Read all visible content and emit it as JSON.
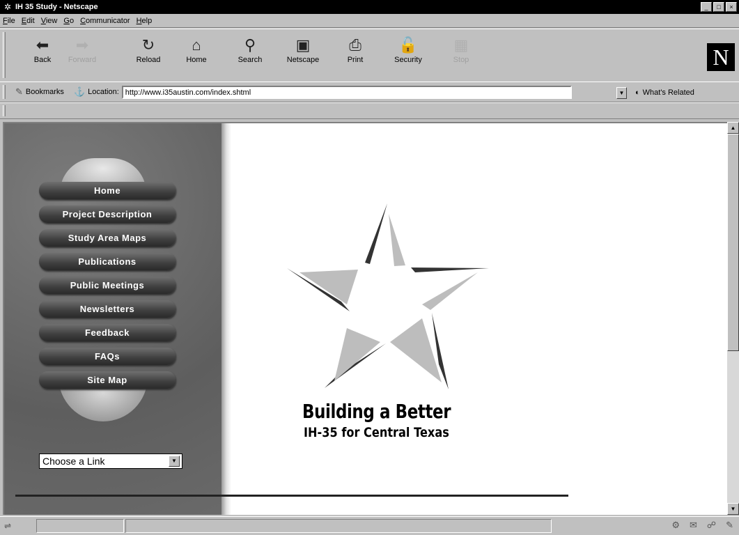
{
  "window": {
    "title": "IH 35 Study - Netscape",
    "controls": [
      "_",
      "□",
      "×"
    ]
  },
  "menu": [
    "File",
    "Edit",
    "View",
    "Go",
    "Communicator",
    "Help"
  ],
  "nav_buttons": [
    {
      "label": "Back",
      "icon": "back-arrow-icon",
      "glyph": "⬅",
      "enabled": true
    },
    {
      "label": "Forward",
      "icon": "forward-arrow-icon",
      "glyph": "➡",
      "enabled": false
    },
    {
      "label": "Reload",
      "icon": "reload-icon",
      "glyph": "↻",
      "enabled": true
    },
    {
      "label": "Home",
      "icon": "home-icon",
      "glyph": "⌂",
      "enabled": true
    },
    {
      "label": "Search",
      "icon": "search-icon",
      "glyph": "⚲",
      "enabled": true
    },
    {
      "label": "Netscape",
      "icon": "netscape-icon",
      "glyph": "▣",
      "enabled": true
    },
    {
      "label": "Print",
      "icon": "print-icon",
      "glyph": "⎙",
      "enabled": true
    },
    {
      "label": "Security",
      "icon": "security-lock-icon",
      "glyph": "🔓",
      "enabled": true
    },
    {
      "label": "Stop",
      "icon": "stop-icon",
      "glyph": "▦",
      "enabled": false
    }
  ],
  "netscape_logo": "N",
  "location": {
    "bookmarks_label": "Bookmarks",
    "location_label": "Location:",
    "url": "http://www.i35austin.com/index.shtml",
    "related_label": "What's Related"
  },
  "page": {
    "side_nav": [
      "Home",
      "Project Description",
      "Study Area Maps",
      "Publications",
      "Public Meetings",
      "Newsletters",
      "Feedback",
      "FAQs",
      "Site Map"
    ],
    "choose_link": "Choose a Link",
    "tagline_line1": "Building a Better",
    "tagline_line2": "IH-35 for Central Texas"
  },
  "colors": {
    "chrome": "#c0c0c0",
    "title_bar": "#000000",
    "panel": "#6e6e6e"
  }
}
